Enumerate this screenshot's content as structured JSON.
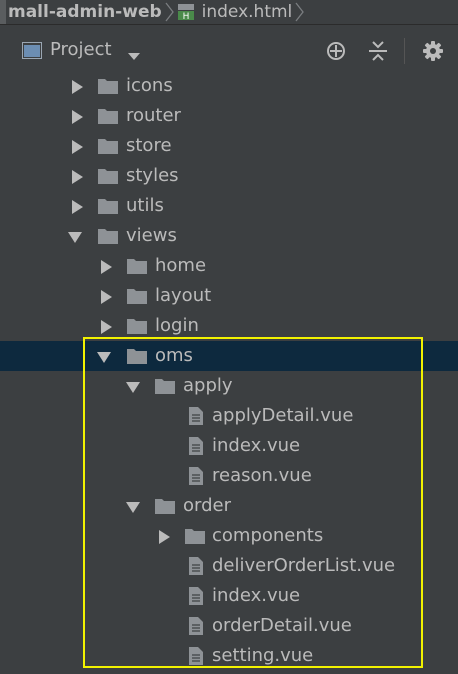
{
  "breadcrumb": {
    "project": "mall-admin-web",
    "file": "index.html"
  },
  "toolbar": {
    "view_label": "Project",
    "buttons": [
      "locate-icon",
      "collapse-all-icon",
      "gear-icon"
    ]
  },
  "tree": {
    "icons": "icons",
    "router": "router",
    "store": "store",
    "styles": "styles",
    "utils": "utils",
    "views": "views",
    "home": "home",
    "layout": "layout",
    "login": "login",
    "oms": "oms",
    "apply": "apply",
    "applyDetail": "applyDetail.vue",
    "apply_index": "index.vue",
    "reason": "reason.vue",
    "order": "order",
    "components": "components",
    "deliverOrderList": "deliverOrderList.vue",
    "order_index": "index.vue",
    "orderDetail": "orderDetail.vue",
    "setting": "setting.vue"
  },
  "colors": {
    "background": "#3c3f41",
    "selection": "#0d293e",
    "highlight_box": "#f2f200",
    "folder": "#8e9296",
    "text": "#bbbbbb"
  }
}
